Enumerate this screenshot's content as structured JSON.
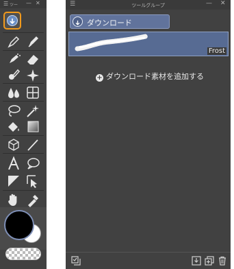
{
  "tool_palette": {
    "title": "ツー",
    "menu_glyph": "☰",
    "minimize_glyph": "—",
    "close_glyph": "✕",
    "download_tool_glyph": "⇩",
    "tools": [
      "pen-icon",
      "fountain-pen-icon",
      "airbrush-icon",
      "eraser-icon",
      "blend-icon",
      "sparkle-icon",
      "ink-drop-icon",
      "grid-frame-icon",
      "lasso-icon",
      "magic-wand-icon",
      "fill-icon",
      "gradient-icon",
      "3d-figure-icon",
      "line-icon",
      "text-icon",
      "balloon-icon",
      "ruler-edit-icon",
      "object-select-icon",
      "hand-icon",
      "eyedropper-icon"
    ],
    "colors": {
      "main": "#000000",
      "sub": "#ffffff",
      "highlight": "#f29a1c"
    }
  },
  "tool_group_panel": {
    "title": "ツールグループ",
    "menu_glyph": "☰",
    "minimize_glyph": "—",
    "close_glyph": "✕",
    "group_tab": {
      "label": "ダウンロード",
      "icon": "download-icon"
    },
    "subtool": {
      "name": "Frost"
    },
    "add_material_label": "ダウンロード素材を追加する",
    "add_material_glyph": "+",
    "colors": {
      "tab": "#61739c",
      "selected_item": "#576b93"
    }
  }
}
